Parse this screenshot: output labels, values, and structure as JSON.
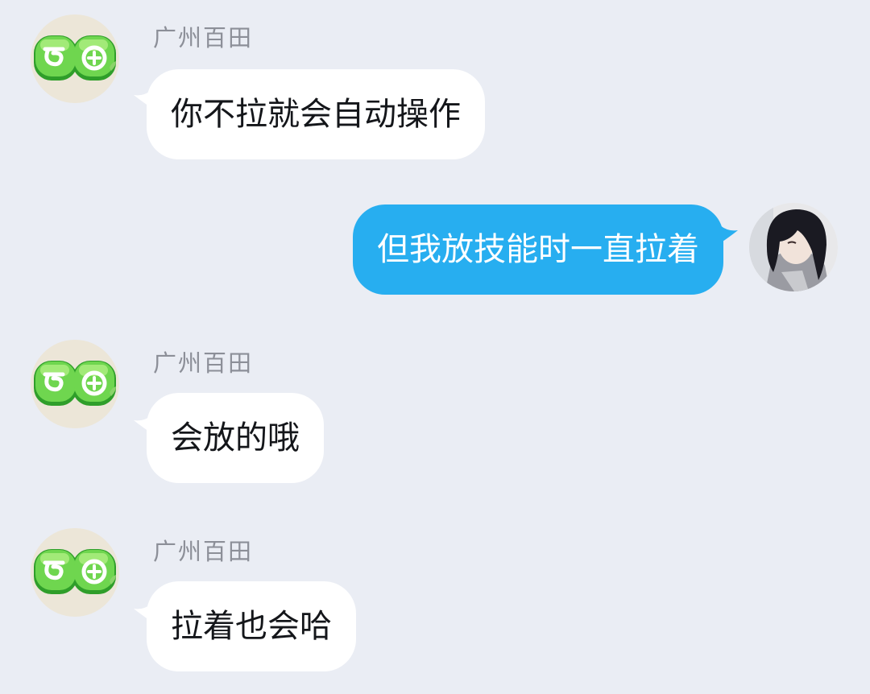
{
  "conversation": {
    "messages": [
      {
        "direction": "incoming",
        "sender": "广州百田",
        "avatar_icon": "baitian-logo-icon",
        "text": "你不拉就会自动操作"
      },
      {
        "direction": "outgoing",
        "avatar_icon": "user-avatar",
        "text": "但我放技能时一直拉着"
      },
      {
        "direction": "incoming",
        "sender": "广州百田",
        "avatar_icon": "baitian-logo-icon",
        "text": "会放的哦"
      },
      {
        "direction": "incoming",
        "sender": "广州百田",
        "avatar_icon": "baitian-logo-icon",
        "text": "拉着也会哈"
      }
    ]
  },
  "colors": {
    "background": "#eaedf4",
    "incoming_bubble": "#ffffff",
    "outgoing_bubble": "#27aef0",
    "sender_name": "#8c8f98",
    "logo_green": "#4cc63a"
  }
}
